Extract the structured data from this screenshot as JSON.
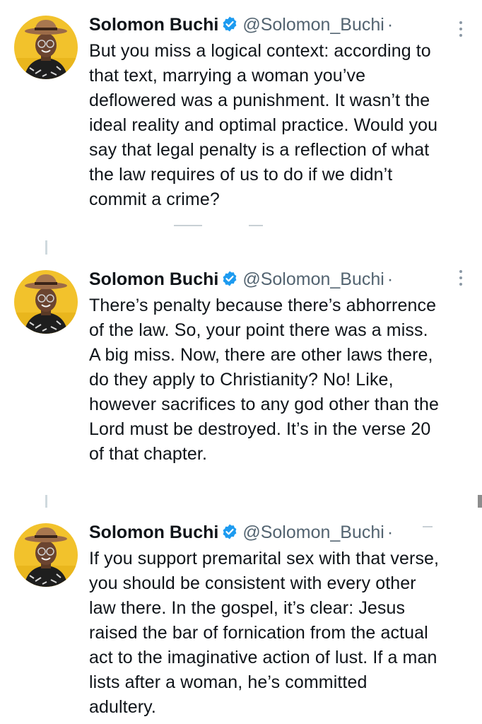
{
  "colors": {
    "text": "#0f1419",
    "secondary": "#536471",
    "verified": "#1d9bf0",
    "thread_line": "#cfd9de",
    "avatar_bg": "#f5c518"
  },
  "tweets": [
    {
      "author": {
        "name": "Solomon Buchi",
        "handle": "@Solomon_Buchi",
        "verified_icon": "verified-badge-icon",
        "separator": "·"
      },
      "lines": [
        "But you miss a logical context: according to",
        "that text, marrying a woman you’ve",
        "deflowered was a punishment. It wasn’t the",
        "ideal reality and optimal practice. Would you",
        "say that legal penalty is a reflection of what",
        "the law requires of us to do if we didn’t",
        "commit a crime?"
      ]
    },
    {
      "author": {
        "name": "Solomon Buchi",
        "handle": "@Solomon_Buchi",
        "verified_icon": "verified-badge-icon",
        "separator": "·"
      },
      "lines": [
        "There’s penalty because there’s abhorrence",
        "of the law. So, your point there was a miss.",
        "A big miss. Now, there are other laws there,",
        "do they apply to Christianity? No! Like,",
        "however sacrifices to any god other than the",
        "Lord must be destroyed. It’s in the verse 20",
        "of that chapter."
      ]
    },
    {
      "author": {
        "name": "Solomon Buchi",
        "handle": "@Solomon_Buchi",
        "verified_icon": "verified-badge-icon",
        "separator": "·"
      },
      "lines": [
        "If you support premarital sex with that verse,",
        "you should be consistent with every other",
        "law there. In the gospel, it’s clear: Jesus",
        "raised the bar of fornication from the actual",
        "act to the imaginative action of lust. If a man",
        "lists after a woman, he’s committed",
        "adultery."
      ]
    }
  ]
}
